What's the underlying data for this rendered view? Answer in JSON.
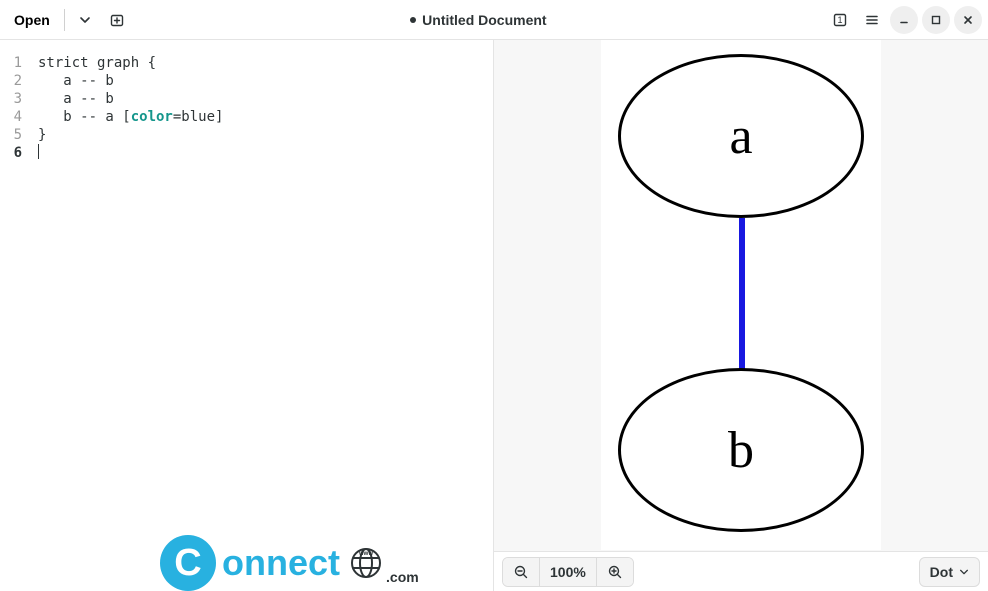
{
  "header": {
    "open_label": "Open",
    "title": "Untitled Document",
    "modified": true
  },
  "editor": {
    "lines": [
      "strict graph {",
      "   a -- b",
      "   a -- b",
      "   b -- a [color=blue]",
      "}",
      ""
    ],
    "cursor_line": 6
  },
  "code_tokens": {
    "l1": "strict graph {",
    "l2": "   a -- b",
    "l3": "   a -- b",
    "l4_pre": "   b -- a [",
    "l4_kw": "color",
    "l4_post": "=blue]",
    "l5": "}"
  },
  "line_numbers": [
    "1",
    "2",
    "3",
    "4",
    "5",
    "6"
  ],
  "graph": {
    "node_a": "a",
    "node_b": "b",
    "edge_color": "#1818e0"
  },
  "preview_toolbar": {
    "zoom_level": "100%",
    "engine": "Dot"
  },
  "watermark": {
    "letter": "C",
    "text": "onnect",
    "suffix": ".com"
  },
  "icons": {
    "chevron_down": "chevron-down-icon",
    "new_tab": "new-tab-icon",
    "panel": "panel-toggle-icon",
    "hamburger": "hamburger-menu-icon",
    "minimize": "minimize-icon",
    "maximize": "maximize-icon",
    "close": "close-icon",
    "zoom_out": "zoom-out-icon",
    "zoom_in": "zoom-in-icon",
    "globe": "globe-icon"
  }
}
